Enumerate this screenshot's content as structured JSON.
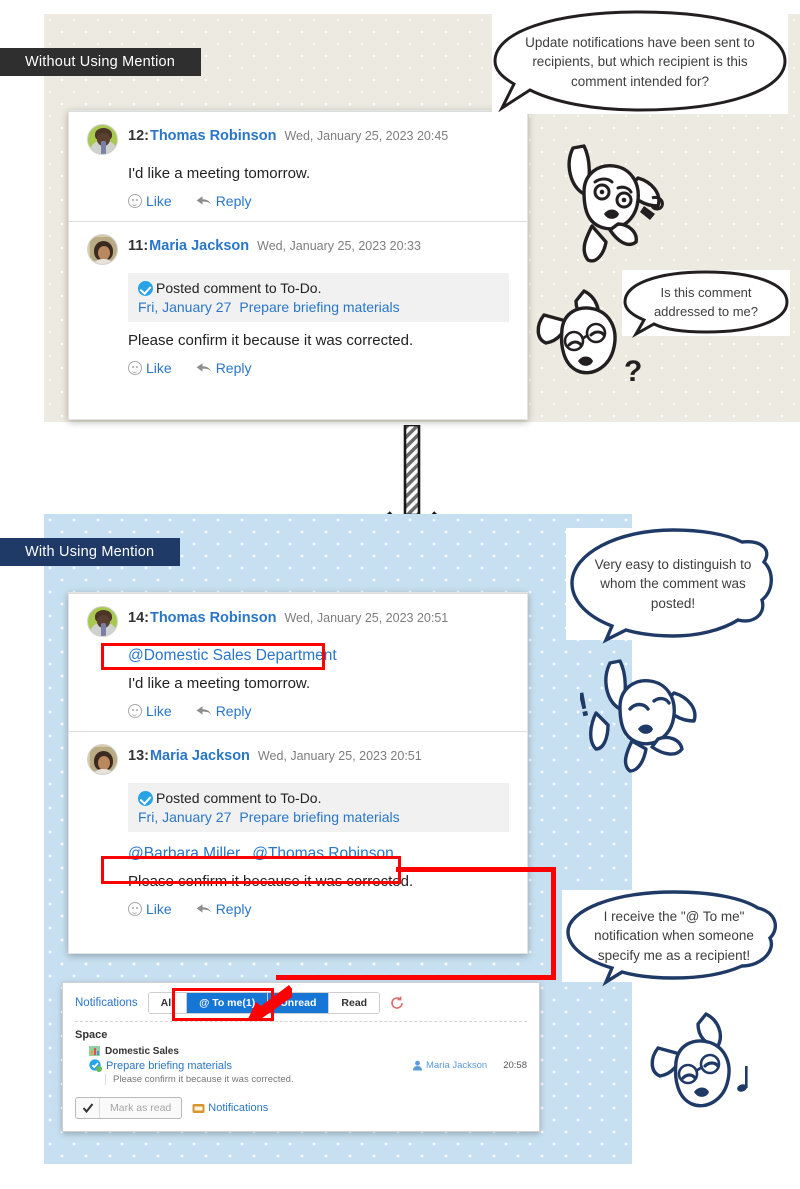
{
  "sections": {
    "top": {
      "banner": "Without Using Mention"
    },
    "bottom": {
      "banner": "With Using Mention"
    }
  },
  "top_comments": [
    {
      "num": "12:",
      "name": "Thomas Robinson",
      "date": "Wed, January 25, 2023 20:45",
      "text": "I'd like a meeting tomorrow.",
      "like": "Like",
      "reply": "Reply"
    },
    {
      "num": "11:",
      "name": "Maria Jackson",
      "date": "Wed, January 25, 2023 20:33",
      "quote_title": "Posted comment to To-Do.",
      "quote_date": "Fri, January 27",
      "quote_task": "Prepare briefing materials",
      "text": "Please confirm it because it was corrected.",
      "like": "Like",
      "reply": "Reply"
    }
  ],
  "bottom_comments": [
    {
      "num": "14:",
      "name": "Thomas Robinson",
      "date": "Wed, January 25, 2023 20:51",
      "mention": "@Domestic Sales Department",
      "text": "I'd like a meeting tomorrow.",
      "like": "Like",
      "reply": "Reply"
    },
    {
      "num": "13:",
      "name": "Maria Jackson",
      "date": "Wed, January 25, 2023 20:51",
      "quote_title": "Posted comment to To-Do.",
      "quote_date": "Fri, January 27",
      "quote_task": "Prepare briefing materials",
      "mention_1": "@Barbara Miller",
      "mention_2": "@Thomas Robinson",
      "text": "Please confirm it because it was corrected.",
      "like": "Like",
      "reply": "Reply"
    }
  ],
  "notifications": {
    "title": "Notifications",
    "tabs": [
      {
        "label": "All",
        "active": false
      },
      {
        "label": "@ To me(1)",
        "active": true
      },
      {
        "label": "Unread",
        "active": true
      },
      {
        "label": "Read",
        "active": false
      }
    ],
    "section_label": "Space",
    "space_name": "Domestic Sales",
    "item_title": "Prepare briefing materials",
    "item_sub": "Please confirm it because it was corrected.",
    "item_user": "Maria Jackson",
    "item_time": "20:58",
    "mark_as_read": "Mark as read",
    "footer_link": "Notifications"
  },
  "bubbles": {
    "b1": "Update notifications have been sent to recipients, but which recipient is this comment intended for?",
    "b2": "Is this comment addressed to me?",
    "b3": "Very easy to distinguish to whom the comment was posted!",
    "b4": "I receive the \"@ To me\" notification when someone specify me as a recipient!"
  },
  "colors": {
    "accent_blue": "#2976c9",
    "highlight_red": "#ff0000",
    "banner_top": "#2f2f2f",
    "banner_bottom": "#1f3a66",
    "bg_top": "#edeae1",
    "bg_bottom": "#c7e0f1",
    "tab_active": "#1576d6"
  }
}
